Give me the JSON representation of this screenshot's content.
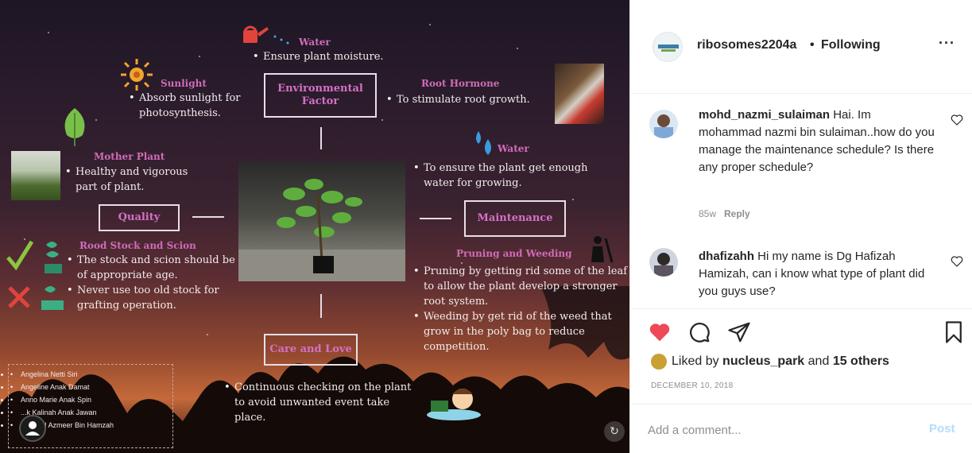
{
  "poster": {
    "environmental_box": "Environmental Factor",
    "water_top": {
      "title": "Water",
      "bullet": "Ensure plant moisture."
    },
    "sunlight": {
      "title": "Sunlight",
      "bullet": "Absorb sunlight for photosynthesis."
    },
    "root_hormone": {
      "title": "Root Hormone",
      "bullet": "To stimulate root growth."
    },
    "mother_plant": {
      "title": "Mother Plant",
      "bullet": "Healthy and vigorous part of plant."
    },
    "water_right": {
      "title": "Water",
      "bullet": "To ensure the plant get enough water for growing."
    },
    "quality_box": "Quality",
    "maintenance_box": "Maintenance",
    "rootstock": {
      "title": "Rood Stock and Scion",
      "bullets": [
        "The stock and scion should be of appropriate age.",
        "Never use too old stock for grafting operation."
      ]
    },
    "pruning": {
      "title": "Pruning and Weeding",
      "bullets": [
        "Pruning by getting rid some of the leaf to allow the plant develop a stronger root system.",
        "Weeding by get rid of the weed that grow in the poly bag to reduce competition."
      ]
    },
    "care_box": "Care and Love",
    "care_bullet": "Continuous checking on the plant to avoid unwanted event take place.",
    "members": [
      "Angelina Netti Siri",
      "Angeline Anak Damat",
      "Anno Marie Anak Spin",
      "...k Kalinah Anak Jawan",
      "...mmad Azmeer Bin Hamzah"
    ]
  },
  "header": {
    "username": "ribosomes2204a",
    "separator": "•",
    "follow_status": "Following",
    "more": "···"
  },
  "comments": [
    {
      "username": "mohd_nazmi_sulaiman",
      "text": "Hai. Im mohammad nazmi bin sulaiman..how do you manage the maintenance schedule? Is there any proper schedule?",
      "age": "85w",
      "reply_label": "Reply"
    },
    {
      "username": "dhafizahh",
      "text": "Hi my name is Dg Hafizah Hamizah, can i know what type of plant did you guys use?"
    }
  ],
  "likes": {
    "prefix": "Liked by",
    "user": "nucleus_park",
    "joiner": "and",
    "others": "15 others"
  },
  "date": "DECEMBER 10, 2018",
  "add_comment": {
    "placeholder": "Add a comment...",
    "post_label": "Post"
  },
  "colors": {
    "like_red": "#ed4956",
    "post_disabled_blue": "#b3dbff",
    "poster_title_pink": "#d06cb8"
  },
  "icons": [
    "heart-icon",
    "comment-icon",
    "share-icon",
    "bookmark-icon",
    "more-icon"
  ]
}
